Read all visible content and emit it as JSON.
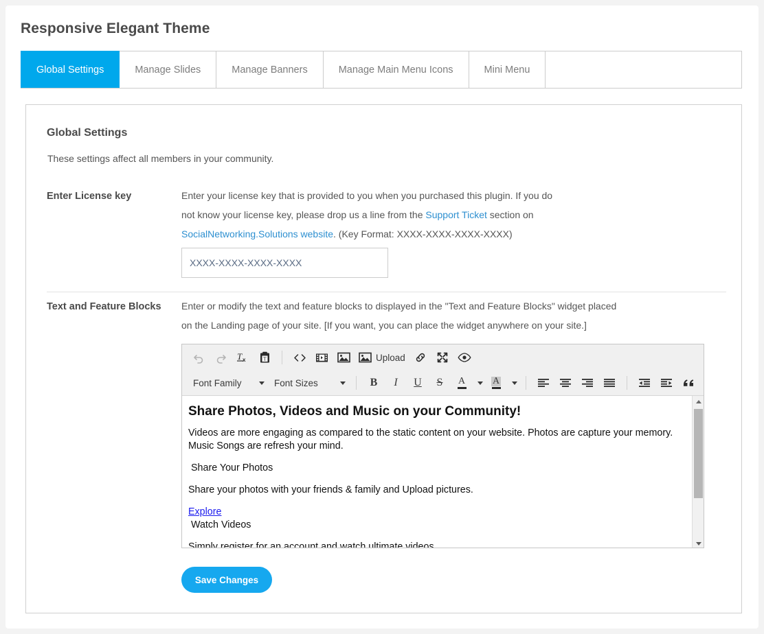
{
  "page": {
    "title": "Responsive Elegant Theme"
  },
  "tabs": [
    {
      "label": "Global Settings",
      "active": true
    },
    {
      "label": "Manage Slides",
      "active": false
    },
    {
      "label": "Manage Banners",
      "active": false
    },
    {
      "label": "Manage Main Menu Icons",
      "active": false
    },
    {
      "label": "Mini Menu",
      "active": false
    }
  ],
  "section": {
    "title": "Global Settings",
    "subtitle": "These settings affect all members in your community."
  },
  "license": {
    "label": "Enter License key",
    "help_line1_a": "Enter your license key that is provided to you when you purchased this plugin. If you do",
    "help_line2_a": "not know your license key, please drop us a line from the ",
    "help_link1": "Support Ticket",
    "help_line2_b": " section on",
    "help_link2": "SocialNetworking.Solutions website",
    "help_line3_b": ". (Key Format: XXXX-XXXX-XXXX-XXXX)",
    "input_value": "XXXX-XXXX-XXXX-XXXX",
    "input_placeholder": "XXXX-XXXX-XXXX-XXXX"
  },
  "blocks": {
    "label": "Text and Feature Blocks",
    "help_line1": "Enter or modify the text and feature blocks to displayed in the \"Text and Feature Blocks\" widget placed",
    "help_line2": "on the Landing page of your site. [If you want, you can place the widget anywhere on your site.]"
  },
  "editor": {
    "toolbar_row1": [
      {
        "name": "undo-icon",
        "label": ""
      },
      {
        "name": "redo-icon",
        "label": ""
      },
      {
        "name": "remove-format-icon",
        "label": ""
      },
      {
        "name": "paste-text-icon",
        "label": ""
      },
      {
        "name": "source-code-icon",
        "label": ""
      },
      {
        "name": "insert-video-icon",
        "label": ""
      },
      {
        "name": "insert-image-icon",
        "label": ""
      },
      {
        "name": "upload-icon",
        "label": "Upload"
      },
      {
        "name": "insert-link-icon",
        "label": ""
      },
      {
        "name": "fullscreen-icon",
        "label": ""
      },
      {
        "name": "preview-icon",
        "label": ""
      }
    ],
    "font_family_label": "Font Family",
    "font_sizes_label": "Font Sizes",
    "format_buttons": [
      {
        "name": "bold-button",
        "glyph": "B"
      },
      {
        "name": "italic-button",
        "glyph": "I"
      },
      {
        "name": "underline-button",
        "glyph": "U"
      },
      {
        "name": "strikethrough-button",
        "glyph": "S"
      }
    ],
    "text_color_glyph": "A",
    "background_color_glyph": "A",
    "content": {
      "heading": "Share Photos, Videos and Music on your Community!",
      "paragraph1": "Videos are more engaging as compared to the static content on your website. Photos are capture your memory. Music Songs are refresh your mind.",
      "subheading1": "Share Your Photos",
      "paragraph2": "Share your photos with your friends & family and Upload pictures.",
      "link1": "Explore",
      "subheading2": "Watch Videos",
      "paragraph3": "Simply register for an account and watch ultimate videos."
    }
  },
  "actions": {
    "save_label": "Save Changes"
  },
  "colors": {
    "accent": "#00a8ec",
    "button": "#16a8ef",
    "link": "#2d8fd0",
    "editor_link": "#1a1aee"
  }
}
